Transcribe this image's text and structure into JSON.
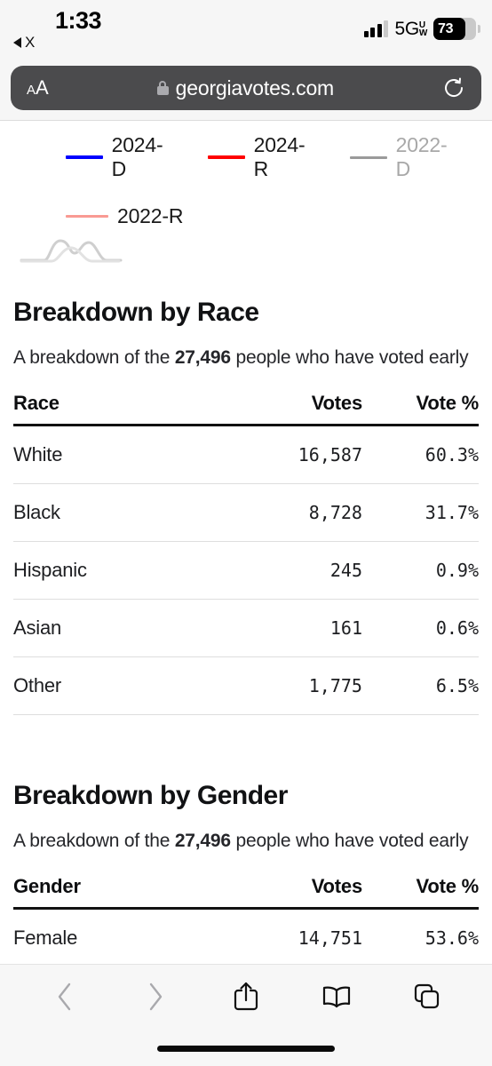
{
  "status_bar": {
    "time": "1:33",
    "back_to_app_label": "X",
    "network_label": "5G",
    "network_sup": "U",
    "network_sub": "W",
    "battery_percent": "73",
    "signal_bars": 4
  },
  "browser": {
    "text_size_small": "A",
    "text_size_large": "A",
    "url": "georgiavotes.com",
    "lock_icon": "lock-icon",
    "reload_icon": "reload-icon",
    "back_icon": "chevron-left-icon",
    "forward_icon": "chevron-right-icon",
    "share_icon": "share-icon",
    "bookmarks_icon": "book-icon",
    "tabs_icon": "tabs-icon"
  },
  "chart_legend": {
    "items": [
      {
        "label": "2024-D",
        "color": "#0000ff",
        "muted": false
      },
      {
        "label": "2024-R",
        "color": "#ff0000",
        "muted": false
      },
      {
        "label": "2022-D",
        "color": "#9a9a9a",
        "muted": true
      },
      {
        "label": "2022-R",
        "color": "#f99a93",
        "muted": false
      }
    ]
  },
  "race_section": {
    "title": "Breakdown by Race",
    "subtitle_prefix": "A breakdown of the ",
    "subtitle_count": "27,496",
    "subtitle_suffix": " people who have voted early",
    "headers": {
      "name": "Race",
      "votes": "Votes",
      "pct": "Vote %"
    },
    "rows": [
      {
        "name": "White",
        "votes": "16,587",
        "pct": "60.3%"
      },
      {
        "name": "Black",
        "votes": "8,728",
        "pct": "31.7%"
      },
      {
        "name": "Hispanic",
        "votes": "245",
        "pct": "0.9%"
      },
      {
        "name": "Asian",
        "votes": "161",
        "pct": "0.6%"
      },
      {
        "name": "Other",
        "votes": "1,775",
        "pct": "6.5%"
      }
    ]
  },
  "gender_section": {
    "title": "Breakdown by Gender",
    "subtitle_prefix": "A breakdown of the ",
    "subtitle_count": "27,496",
    "subtitle_suffix": " people who have voted early",
    "headers": {
      "name": "Gender",
      "votes": "Votes",
      "pct": "Vote %"
    },
    "rows": [
      {
        "name": "Female",
        "votes": "14,751",
        "pct": "53.6%"
      }
    ]
  },
  "chart_data": {
    "type": "line",
    "title": "",
    "legend_position": "top",
    "series": [
      {
        "name": "2024-D",
        "color": "#0000ff",
        "visible": true
      },
      {
        "name": "2024-R",
        "color": "#ff0000",
        "visible": true
      },
      {
        "name": "2022-D",
        "color": "#9a9a9a",
        "visible": false
      },
      {
        "name": "2022-R",
        "color": "#f99a93",
        "visible": true
      }
    ],
    "note": "chart plot area scrolled off-screen; only legend and a faint curve fragment visible"
  }
}
